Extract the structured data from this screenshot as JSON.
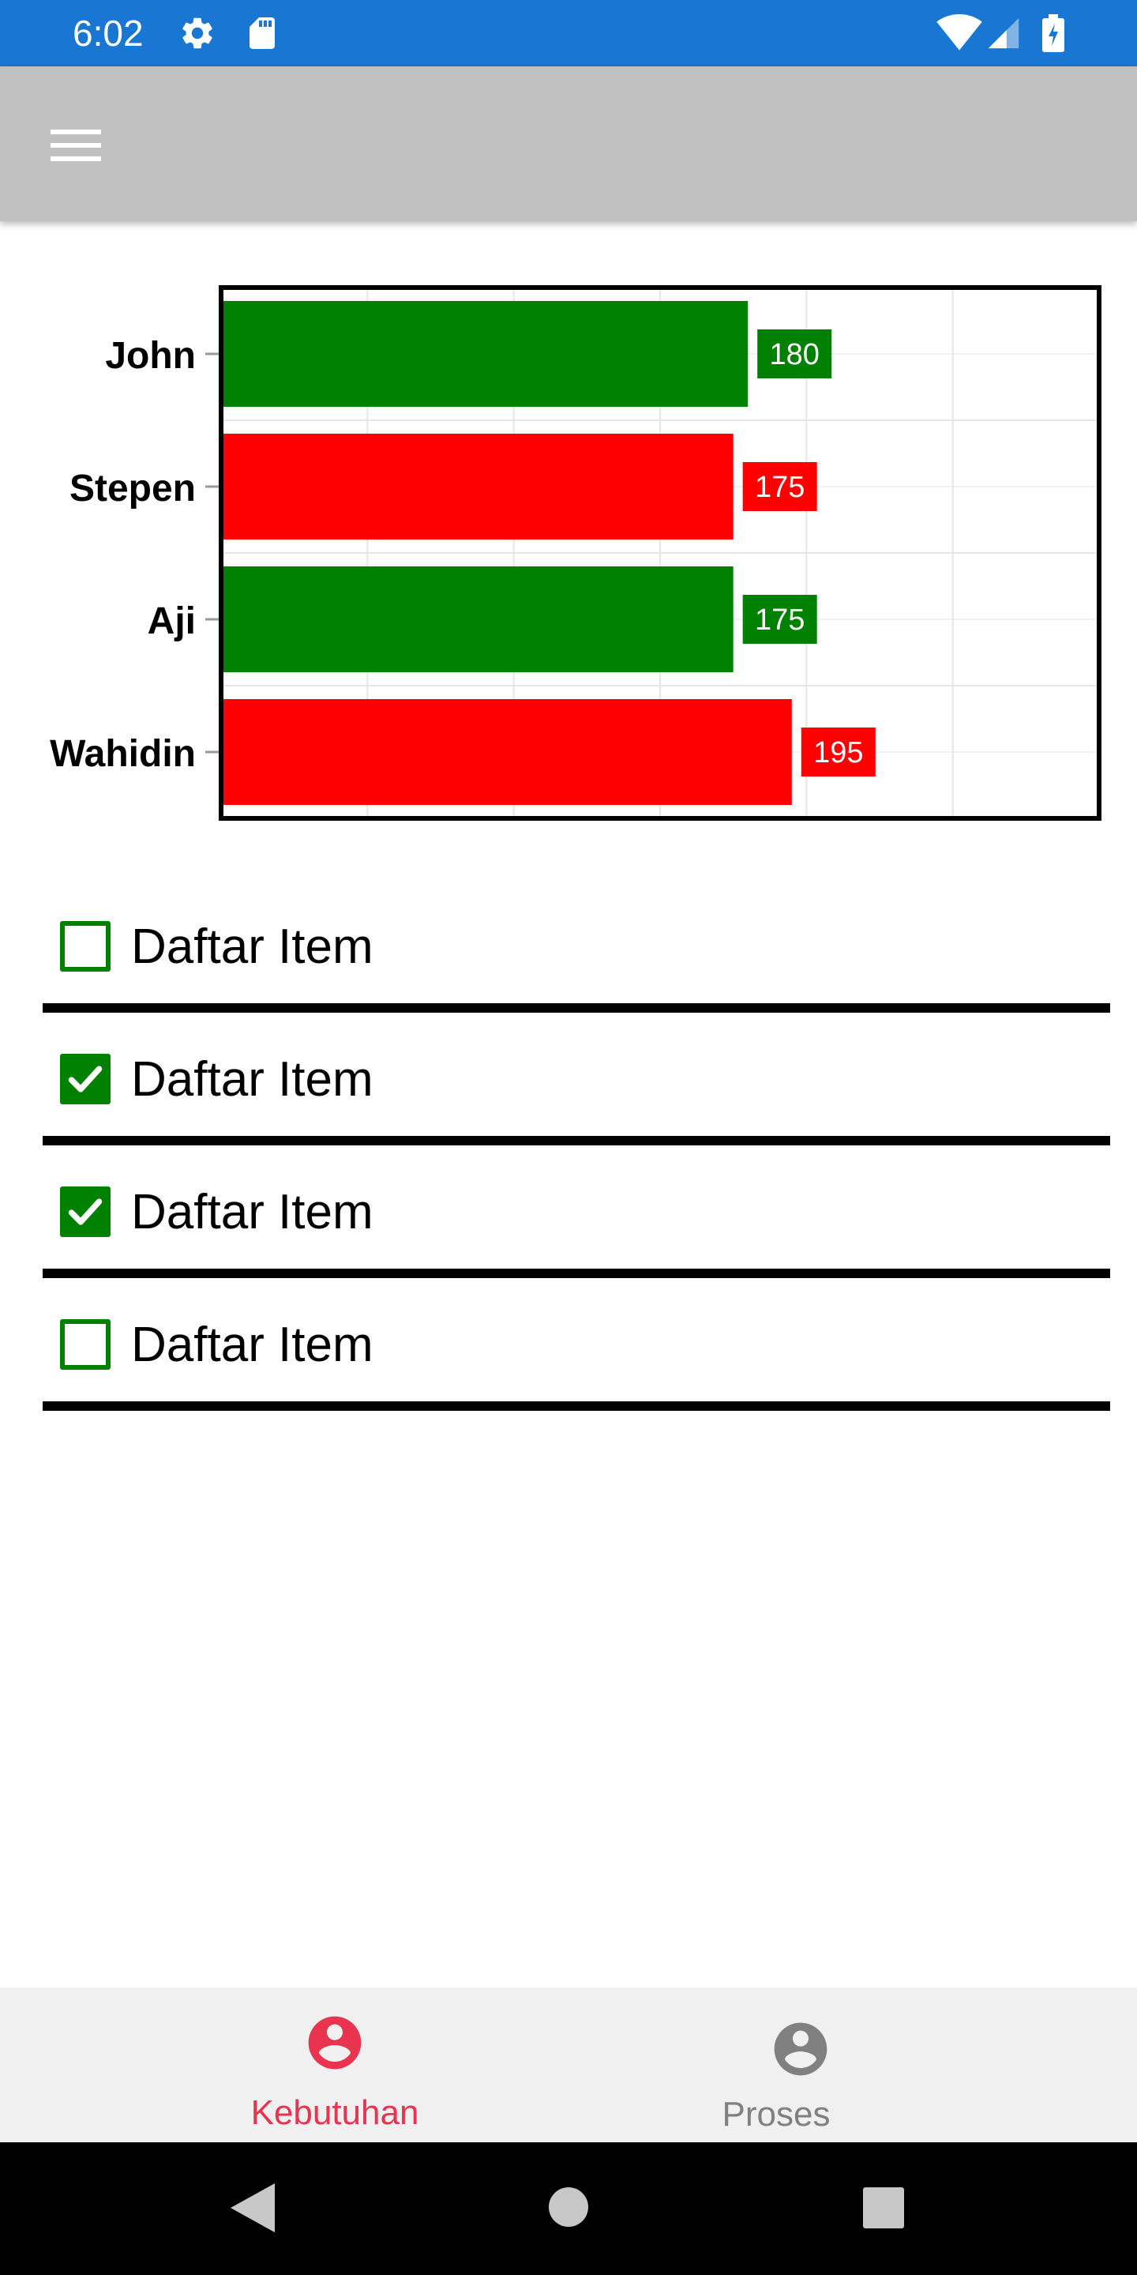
{
  "status_bar": {
    "time": "6:02",
    "icons": [
      "settings-icon",
      "sd-card-icon",
      "wifi-icon",
      "signal-icon",
      "battery-charging-icon"
    ]
  },
  "app_bar": {
    "menu_icon": "hamburger-menu-icon"
  },
  "chart_data": {
    "type": "bar",
    "orientation": "horizontal",
    "categories": [
      "John",
      "Stepen",
      "Aji",
      "Wahidin"
    ],
    "values": [
      180,
      175,
      175,
      195
    ],
    "bar_colors": [
      "#008000",
      "#FF0000",
      "#008000",
      "#FF0000"
    ],
    "xlim": [
      0,
      300
    ],
    "grid": true,
    "data_labels": true,
    "title": "",
    "xlabel": "",
    "ylabel": ""
  },
  "checklist": {
    "items": [
      {
        "label": "Daftar Item",
        "checked": false
      },
      {
        "label": "Daftar Item",
        "checked": true
      },
      {
        "label": "Daftar Item",
        "checked": true
      },
      {
        "label": "Daftar Item",
        "checked": false
      }
    ],
    "check_color": "#008000"
  },
  "bottom_nav": {
    "tabs": [
      {
        "label": "Kebutuhan",
        "icon": "account-circle-icon",
        "active": true,
        "color": "#e8344e"
      },
      {
        "label": "Proses",
        "icon": "account-circle-icon",
        "active": false,
        "color": "#808080"
      }
    ]
  },
  "system_nav": {
    "icons": [
      "back-icon",
      "home-icon",
      "recents-icon"
    ]
  }
}
